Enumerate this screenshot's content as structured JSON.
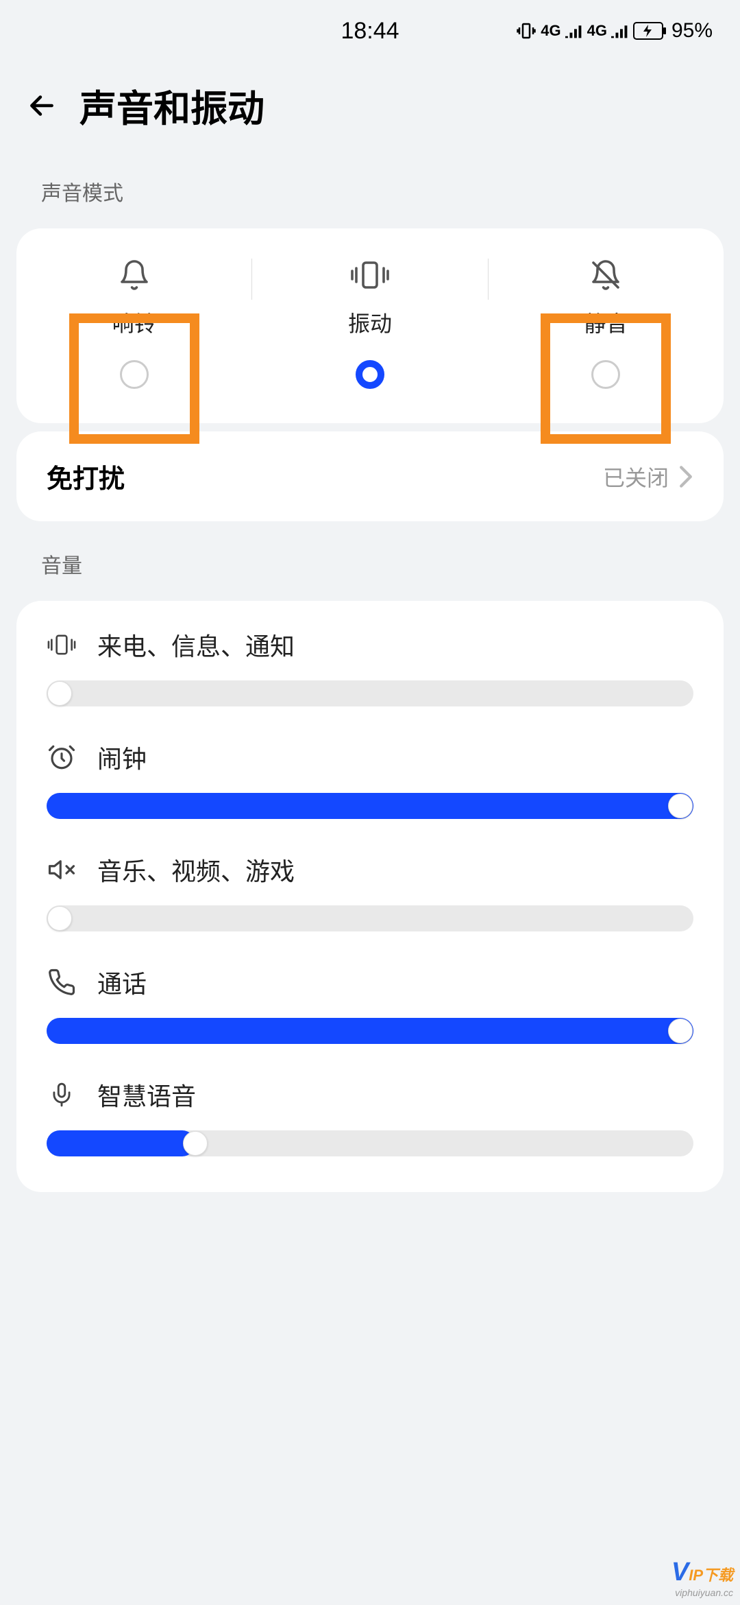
{
  "status": {
    "time": "18:44",
    "battery": "95%"
  },
  "header": {
    "title": "声音和振动"
  },
  "sections": {
    "sound_mode_label": "声音模式",
    "volume_label": "音量"
  },
  "modes": {
    "ring": "响铃",
    "vibrate": "振动",
    "mute": "静音",
    "selected": "vibrate"
  },
  "dnd": {
    "title": "免打扰",
    "status": "已关闭"
  },
  "volumes": {
    "ringtone": {
      "label": "来电、信息、通知",
      "value": 0
    },
    "alarm": {
      "label": "闹钟",
      "value": 100
    },
    "media": {
      "label": "音乐、视频、游戏",
      "value": 0
    },
    "call": {
      "label": "通话",
      "value": 100
    },
    "voice": {
      "label": "智慧语音",
      "value": 23
    }
  },
  "watermark": {
    "main": "IP下载",
    "sub": "viphuiyuan.cc"
  }
}
